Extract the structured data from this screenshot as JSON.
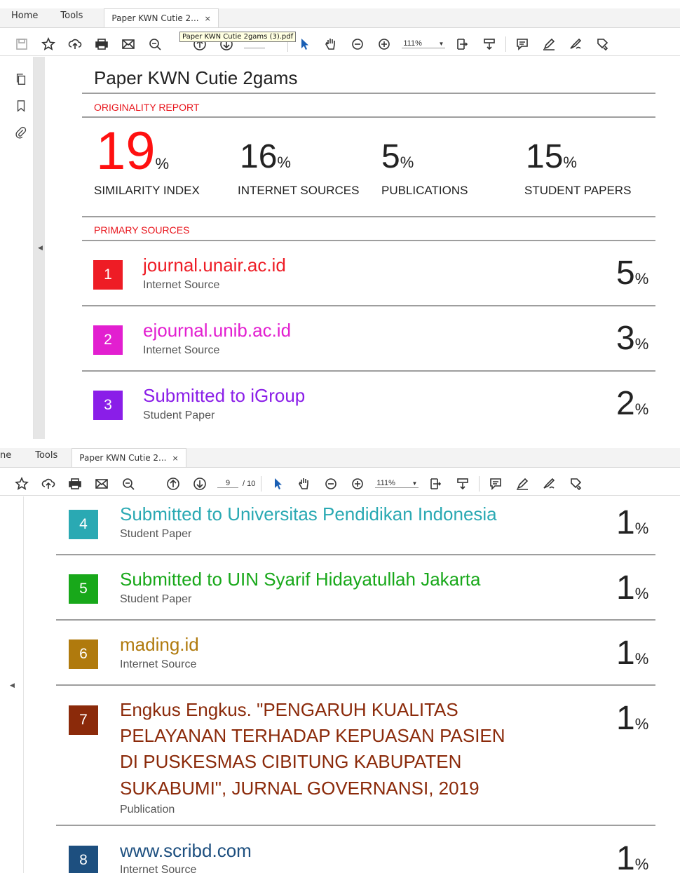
{
  "viewer": {
    "nav_home": "Home",
    "nav_home_cropped": "ne",
    "nav_tools": "Tools",
    "doc_tab": "Paper KWN Cutie 2...",
    "tab_close": "×",
    "tooltip": "Paper KWN Cutie 2gams (3).pdf",
    "page_current": "9",
    "page_total": "/ 10",
    "zoom": "111%"
  },
  "report": {
    "title": "Paper KWN Cutie 2gams",
    "originality_label": "ORIGINALITY REPORT",
    "primary_label": "PRIMARY SOURCES",
    "pct_sign": "%",
    "stats": [
      {
        "value": "19",
        "label": "SIMILARITY INDEX"
      },
      {
        "value": "16",
        "label": "INTERNET SOURCES"
      },
      {
        "value": "5",
        "label": "PUBLICATIONS"
      },
      {
        "value": "15",
        "label": "STUDENT PAPERS"
      }
    ],
    "sources": [
      {
        "num": "1",
        "name": "journal.unair.ac.id",
        "type": "Internet Source",
        "pct": "5",
        "color": "#ee1c25"
      },
      {
        "num": "2",
        "name": "ejournal.unib.ac.id",
        "type": "Internet Source",
        "pct": "3",
        "color": "#e21fd0"
      },
      {
        "num": "3",
        "name": "Submitted to iGroup",
        "type": "Student Paper",
        "pct": "2",
        "color": "#8a1ee8"
      },
      {
        "num": "4",
        "name": "Submitted to Universitas Pendidikan Indonesia",
        "type": "Student Paper",
        "pct": "1",
        "color": "#2aa9b3"
      },
      {
        "num": "5",
        "name": "Submitted to UIN Syarif Hidayatullah Jakarta",
        "type": "Student Paper",
        "pct": "1",
        "color": "#18a81a"
      },
      {
        "num": "6",
        "name": "mading.id",
        "type": "Internet Source",
        "pct": "1",
        "color": "#b07a0d"
      },
      {
        "num": "7",
        "name_lines": [
          "Engkus Engkus. \"PENGARUH KUALITAS",
          "PELAYANAN TERHADAP KEPUASAN PASIEN",
          "DI PUSKESMAS CIBITUNG KABUPATEN",
          "SUKABUMI\", JURNAL GOVERNANSI, 2019"
        ],
        "type": "Publication",
        "pct": "1",
        "color": "#8b2a0a"
      },
      {
        "num": "8",
        "name": "www.scribd.com",
        "type": "Internet Source",
        "pct": "1",
        "color": "#1d4f7f"
      }
    ]
  }
}
